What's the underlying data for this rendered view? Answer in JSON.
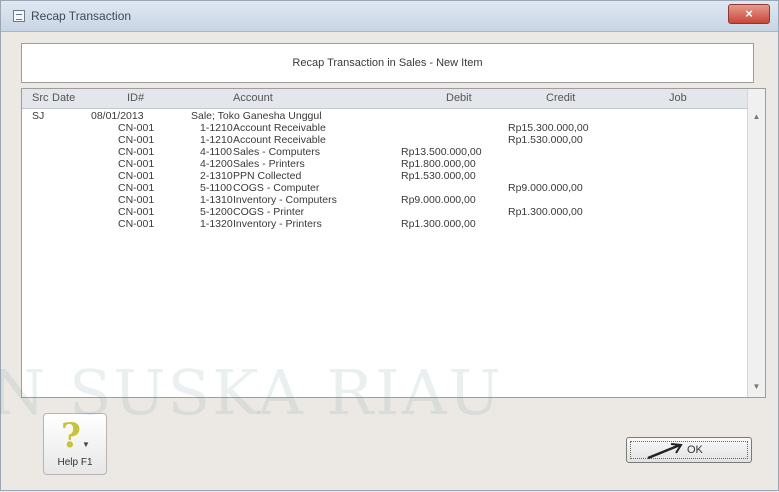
{
  "window": {
    "title": "Recap Transaction",
    "close_symbol": "×"
  },
  "header": {
    "text": "Recap Transaction in Sales - New Item"
  },
  "grid": {
    "columns": [
      "Src",
      "Date",
      "ID#",
      "Account",
      "Debit",
      "Credit",
      "Job"
    ],
    "first_row": {
      "src": "SJ",
      "date": "08/01/2013",
      "description": "Sale; Toko Ganesha Unggul"
    },
    "rows": [
      {
        "id": "CN-001",
        "account_no": "1-1210",
        "account_name": "Account Receivable",
        "debit": "",
        "credit": "Rp15.300.000,00"
      },
      {
        "id": "CN-001",
        "account_no": "1-1210",
        "account_name": "Account Receivable",
        "debit": "",
        "credit": "Rp1.530.000,00"
      },
      {
        "id": "CN-001",
        "account_no": "4-1100",
        "account_name": "Sales - Computers",
        "debit": "Rp13.500.000,00",
        "credit": ""
      },
      {
        "id": "CN-001",
        "account_no": "4-1200",
        "account_name": "Sales - Printers",
        "debit": "Rp1.800.000,00",
        "credit": ""
      },
      {
        "id": "CN-001",
        "account_no": "2-1310",
        "account_name": "PPN Collected",
        "debit": "Rp1.530.000,00",
        "credit": ""
      },
      {
        "id": "CN-001",
        "account_no": "5-1100",
        "account_name": "COGS - Computer",
        "debit": "",
        "credit": "Rp9.000.000,00"
      },
      {
        "id": "CN-001",
        "account_no": "1-1310",
        "account_name": "Inventory - Computers",
        "debit": "Rp9.000.000,00",
        "credit": ""
      },
      {
        "id": "CN-001",
        "account_no": "5-1200",
        "account_name": "COGS - Printer",
        "debit": "",
        "credit": "Rp1.300.000,00"
      },
      {
        "id": "CN-001",
        "account_no": "1-1320",
        "account_name": "Inventory - Printers",
        "debit": "Rp1.300.000,00",
        "credit": ""
      }
    ]
  },
  "buttons": {
    "help_label": "Help F1",
    "ok_label": "OK"
  },
  "watermark": {
    "text": "N SUSKA RIAU"
  },
  "colors": {
    "titlebar": "#c7d5e4",
    "grid_header": "#e3e6ea",
    "close_button": "#c7473a"
  }
}
